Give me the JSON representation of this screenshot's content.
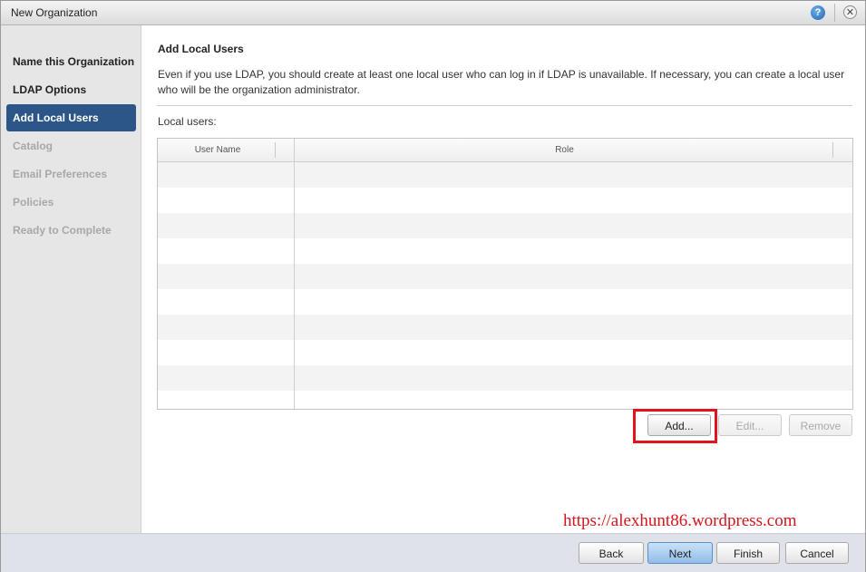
{
  "window": {
    "title": "New Organization",
    "help_icon": "?",
    "close_icon": "✕"
  },
  "sidebar": {
    "steps": [
      {
        "label": "Name this Organization",
        "state": "completed"
      },
      {
        "label": "LDAP Options",
        "state": "completed"
      },
      {
        "label": "Add Local Users",
        "state": "active"
      },
      {
        "label": "Catalog",
        "state": "disabled"
      },
      {
        "label": "Email Preferences",
        "state": "disabled"
      },
      {
        "label": "Policies",
        "state": "disabled"
      },
      {
        "label": "Ready to Complete",
        "state": "disabled"
      }
    ]
  },
  "main": {
    "title": "Add Local Users",
    "description": "Even if you use LDAP, you should create at least one local user who can log in if LDAP is unavailable. If necessary, you can create a local user who will be the organization administrator.",
    "local_users_label": "Local users:",
    "table": {
      "columns": [
        "User Name",
        "Role"
      ],
      "rows": []
    },
    "buttons": {
      "add": "Add...",
      "edit": "Edit...",
      "remove": "Remove"
    }
  },
  "footer": {
    "back": "Back",
    "next": "Next",
    "finish": "Finish",
    "cancel": "Cancel"
  },
  "watermark": "https://alexhunt86.wordpress.com",
  "colors": {
    "active_step": "#2b5687",
    "highlight": "#e0141c",
    "primary_button": "#92bde9",
    "watermark": "#d5141c"
  }
}
